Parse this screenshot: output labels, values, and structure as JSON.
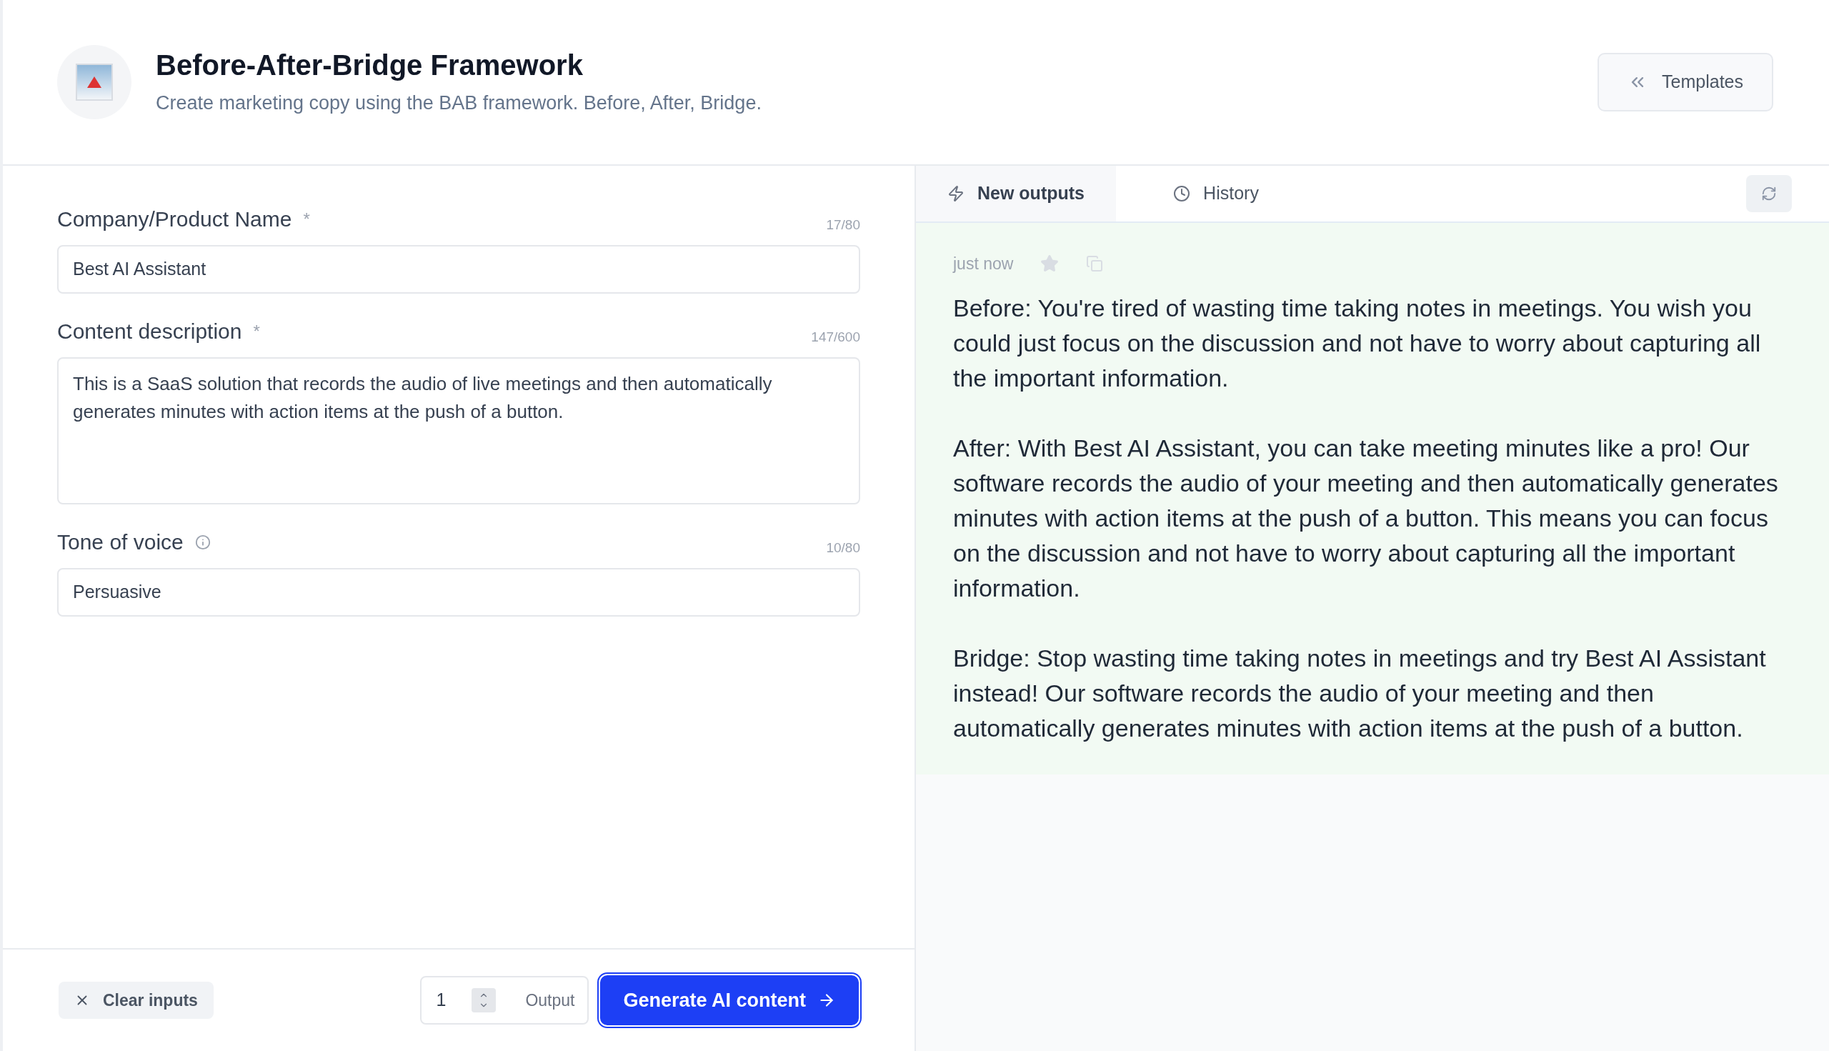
{
  "header": {
    "title": "Before-After-Bridge Framework",
    "subtitle": "Create marketing copy using the BAB framework. Before, After, Bridge.",
    "templates_button": "Templates"
  },
  "fields": [
    {
      "kind": "text",
      "label": "Company/Product Name",
      "required_mark": "*",
      "info": false,
      "counter": "17/80",
      "value": "Best AI Assistant"
    },
    {
      "kind": "textarea",
      "label": "Content description",
      "required_mark": "*",
      "info": false,
      "counter": "147/600",
      "value": "This is a SaaS solution that records the audio of live meetings and then automatically generates minutes with action items at the push of a button."
    },
    {
      "kind": "text",
      "label": "Tone of voice",
      "info": true,
      "counter": "10/80",
      "value": "Persuasive"
    }
  ],
  "footer": {
    "clear_button": "Clear inputs",
    "output_count": "1",
    "output_label": "Output",
    "generate_button": "Generate AI content"
  },
  "tabs": [
    {
      "label": "New outputs",
      "selected": true
    },
    {
      "label": "History",
      "selected": false
    }
  ],
  "output": {
    "time": "just now",
    "starred": false,
    "paragraphs": [
      "Before: You're tired of wasting time taking notes in meetings. You wish you could just focus on the discussion and not have to worry about capturing all the important information.",
      "After: With Best AI Assistant, you can take meeting minutes like a pro! Our software records the audio of your meeting and then automatically generates minutes with action items at the push of a button. This means you can focus on the discussion and not have to worry about capturing all the important information.",
      "Bridge: Stop wasting time taking notes in meetings and try Best AI Assistant instead! Our software records the audio of your meeting and then automatically generates minutes with action items at the push of a button."
    ]
  }
}
